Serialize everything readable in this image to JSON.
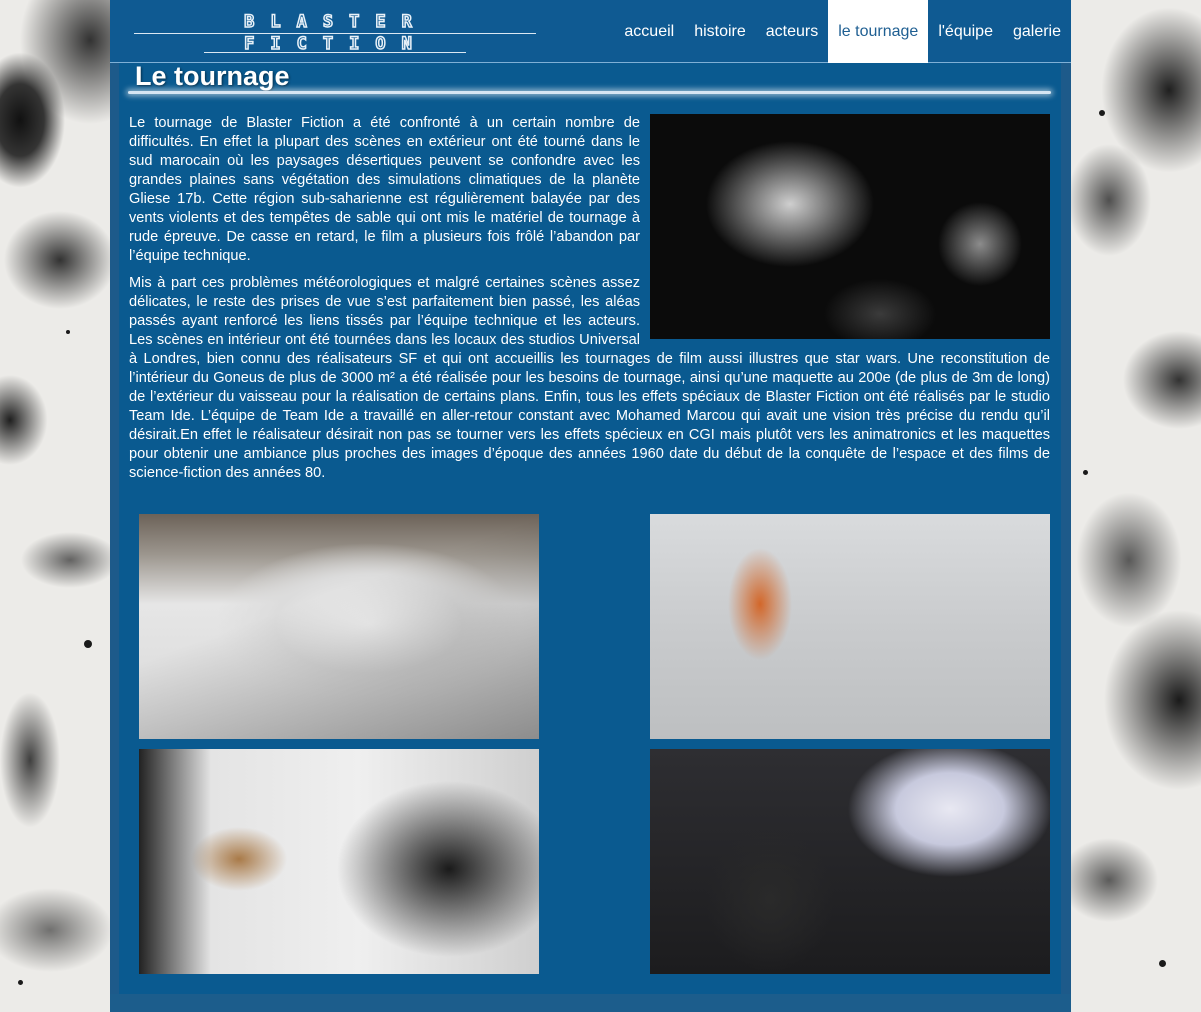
{
  "logo": {
    "line1": "BLASTER",
    "line2": "FICTION"
  },
  "nav": [
    {
      "label": "accueil",
      "active": false
    },
    {
      "label": "histoire",
      "active": false
    },
    {
      "label": "acteurs",
      "active": false
    },
    {
      "label": "le tournage",
      "active": true
    },
    {
      "label": "l'équipe",
      "active": false
    },
    {
      "label": "galerie",
      "active": false
    }
  ],
  "page": {
    "title": "Le tournage",
    "paragraphs": [
      "Le tournage de Blaster Fiction a été confronté à un certain nombre de difficultés. En effet la plupart des scènes en extérieur ont été tourné dans le sud marocain où les paysages désertiques peuvent se confondre avec les grandes plaines sans végétation des simulations climatiques de la planète Gliese 17b. Cette région sub-saharienne est régulièrement balayée par des vents violents et des tempêtes de sable qui ont mis le matériel de tournage à rude épreuve. De casse en retard, le film a plusieurs fois frôlé l’abandon par l’équipe technique.",
      "Mis à part ces problèmes météorologiques et malgré certaines scènes assez délicates, le reste des prises de vue s’est parfaitement bien passé, les aléas passés ayant renforcé les liens tissés par l’équipe technique et les acteurs. Les scènes en intérieur ont été tournées dans les locaux des studios Universal à Londres, bien connu des réalisateurs SF et qui ont accueillis les tournages de film aussi illustres que star wars. Une reconstitution de l’intérieur du Goneus de plus de 3000 m² a été réalisée pour les besoins de tournage, ainsi qu’une maquette au 200e (de plus de 3m de long) de l’extérieur du vaisseau pour la réalisation de certains plans. Enfin, tous les effets spéciaux de Blaster Fiction ont été réalisés par le studio Team Ide. L’équipe de Team Ide a travaillé en aller-retour constant avec Mohamed Marcou qui avait une vision très précise du rendu qu’il désirait.En effet le réalisateur désirait non pas se tourner vers les effets spécieux en CGI mais plutôt vers les animatronics et les maquettes pour obtenir une ambiance plus proches des images d’époque des années 1960 date du début de la conquête de l’espace et des films de science-fiction des années 80."
    ]
  }
}
